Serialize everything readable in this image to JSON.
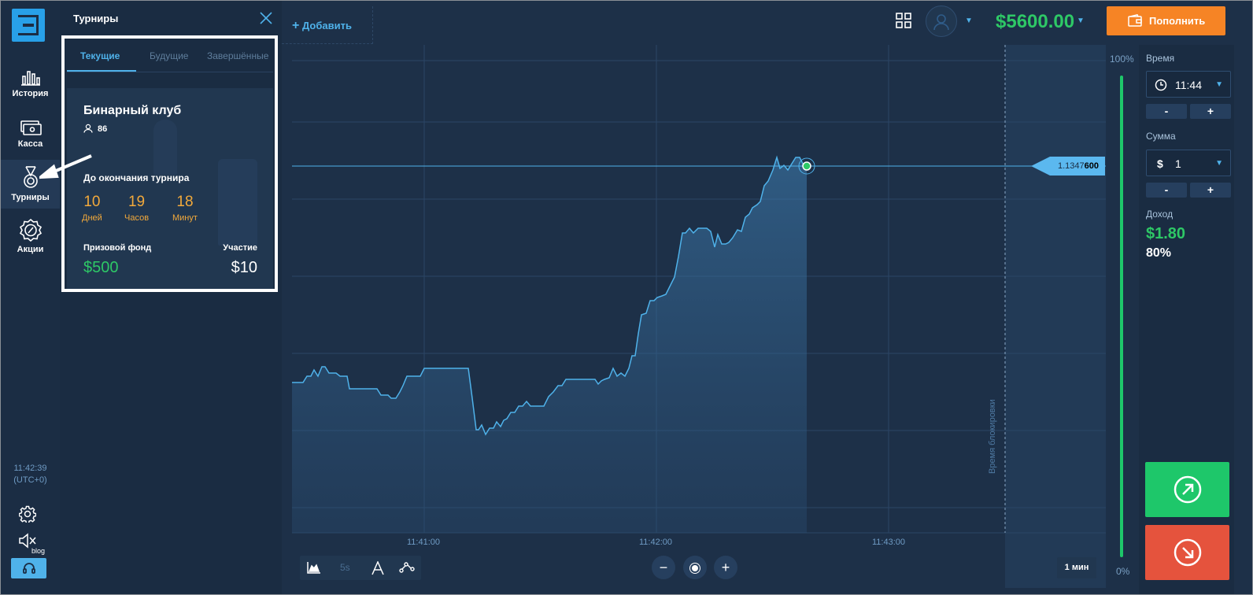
{
  "sidebar": {
    "items": [
      {
        "label": "История",
        "icon": "history-chart-icon"
      },
      {
        "label": "Касса",
        "icon": "cashbox-icon"
      },
      {
        "label": "Турниры",
        "icon": "medal-icon"
      },
      {
        "label": "Акции",
        "icon": "percent-badge-icon"
      }
    ],
    "clock_time": "11:42:39",
    "clock_tz": "(UTC+0)",
    "blog_label": "blog"
  },
  "tournaments": {
    "title": "Турниры",
    "tabs": [
      "Текущие",
      "Будущие",
      "Завершённые"
    ],
    "card": {
      "name": "Бинарный клуб",
      "participants": "86",
      "ends_label": "До окончания турнира",
      "countdown": [
        {
          "value": "10",
          "unit": "Дней"
        },
        {
          "value": "19",
          "unit": "Часов"
        },
        {
          "value": "18",
          "unit": "Минут"
        }
      ],
      "prize_label": "Призовой фонд",
      "prize_value": "$500",
      "entry_label": "Участие",
      "entry_value": "$10"
    }
  },
  "topbar": {
    "add_label": "Добавить",
    "balance": "$5600.00",
    "deposit_label": "Пополнить"
  },
  "chart": {
    "current_price_prefix": "1.1347",
    "current_price_suffix": "600",
    "x_ticks": [
      "11:41:00",
      "11:42:00",
      "11:43:00"
    ],
    "lock_label": "Время блокировки",
    "pct_top": "100%",
    "pct_bottom": "0%",
    "interval_label": "5s",
    "timeframe": "1 мин",
    "series": [
      [
        0,
        486
      ],
      [
        14,
        486
      ],
      [
        19,
        478
      ],
      [
        24,
        478
      ],
      [
        28,
        470
      ],
      [
        33,
        478
      ],
      [
        38,
        466
      ],
      [
        42,
        466
      ],
      [
        47,
        474
      ],
      [
        56,
        474
      ],
      [
        61,
        478
      ],
      [
        70,
        478
      ],
      [
        73,
        494
      ],
      [
        108,
        494
      ],
      [
        113,
        502
      ],
      [
        122,
        502
      ],
      [
        126,
        506
      ],
      [
        132,
        506
      ],
      [
        137,
        498
      ],
      [
        141,
        490
      ],
      [
        146,
        478
      ],
      [
        151,
        478
      ],
      [
        156,
        478
      ],
      [
        163,
        478
      ],
      [
        168,
        468
      ],
      [
        224,
        468
      ],
      [
        229,
        506
      ],
      [
        234,
        546
      ],
      [
        237,
        546
      ],
      [
        241,
        540
      ],
      [
        246,
        552
      ],
      [
        251,
        544
      ],
      [
        256,
        544
      ],
      [
        260,
        536
      ],
      [
        265,
        542
      ],
      [
        269,
        534
      ],
      [
        273,
        532
      ],
      [
        278,
        524
      ],
      [
        283,
        524
      ],
      [
        288,
        516
      ],
      [
        293,
        516
      ],
      [
        298,
        510
      ],
      [
        303,
        516
      ],
      [
        320,
        516
      ],
      [
        326,
        504
      ],
      [
        332,
        498
      ],
      [
        338,
        490
      ],
      [
        343,
        490
      ],
      [
        348,
        482
      ],
      [
        385,
        482
      ],
      [
        389,
        488
      ],
      [
        393,
        484
      ],
      [
        397,
        482
      ],
      [
        403,
        480
      ],
      [
        408,
        468
      ],
      [
        413,
        478
      ],
      [
        418,
        474
      ],
      [
        423,
        478
      ],
      [
        428,
        468
      ],
      [
        432,
        452
      ],
      [
        436,
        452
      ],
      [
        440,
        424
      ],
      [
        444,
        400
      ],
      [
        450,
        398
      ],
      [
        455,
        382
      ],
      [
        460,
        382
      ],
      [
        464,
        378
      ],
      [
        470,
        376
      ],
      [
        475,
        374
      ],
      [
        481,
        362
      ],
      [
        486,
        352
      ],
      [
        491,
        326
      ],
      [
        496,
        296
      ],
      [
        500,
        296
      ],
      [
        505,
        290
      ],
      [
        510,
        296
      ],
      [
        516,
        290
      ],
      [
        521,
        290
      ],
      [
        527,
        290
      ],
      [
        532,
        294
      ],
      [
        537,
        314
      ],
      [
        541,
        298
      ],
      [
        546,
        310
      ],
      [
        551,
        310
      ],
      [
        555,
        308
      ],
      [
        560,
        302
      ],
      [
        566,
        292
      ],
      [
        571,
        294
      ],
      [
        576,
        276
      ],
      [
        581,
        272
      ],
      [
        585,
        264
      ],
      [
        591,
        260
      ],
      [
        595,
        256
      ],
      [
        600,
        236
      ],
      [
        605,
        230
      ],
      [
        611,
        216
      ],
      [
        616,
        200
      ],
      [
        620,
        214
      ],
      [
        625,
        210
      ],
      [
        630,
        216
      ],
      [
        635,
        208
      ],
      [
        640,
        200
      ],
      [
        645,
        200
      ],
      [
        650,
        210
      ],
      [
        654,
        210
      ]
    ]
  },
  "trade": {
    "time_label": "Время",
    "time_value": "11:44",
    "amount_label": "Сумма",
    "amount_currency": "$",
    "amount_value": "1",
    "income_label": "Доход",
    "income_value": "$1.80",
    "income_pct": "80%"
  }
}
